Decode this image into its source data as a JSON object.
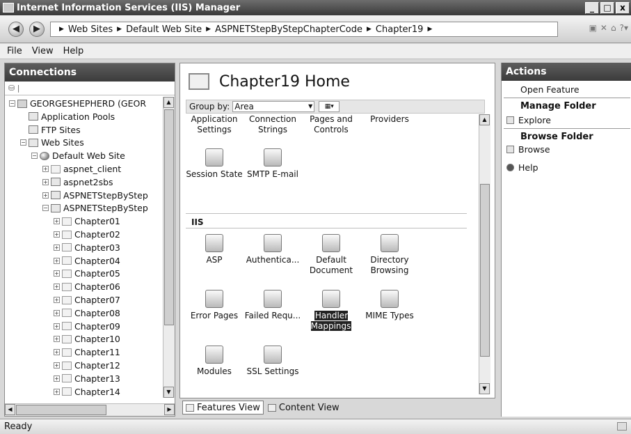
{
  "window": {
    "title": "Internet Information Services (IIS) Manager",
    "controls": [
      "_",
      "□",
      "x"
    ]
  },
  "address": {
    "crumbs": [
      "Web Sites",
      "Default Web Site",
      "ASPNETStepByStepChapterCode",
      "Chapter19"
    ]
  },
  "menu": {
    "items": [
      {
        "label": "File",
        "key": "F"
      },
      {
        "label": "View",
        "key": "V"
      },
      {
        "label": "Help",
        "key": "H"
      }
    ]
  },
  "connections": {
    "title": "Connections",
    "tree": [
      {
        "label": "GEORGESHEPHERD (GEOR",
        "level": 0,
        "exp": "−",
        "icon": "server-icon",
        "cls": "server"
      },
      {
        "label": "Application Pools",
        "level": 1,
        "exp": "",
        "icon": "app-pool-icon",
        "cls": ""
      },
      {
        "label": "FTP Sites",
        "level": 1,
        "exp": "",
        "icon": "ftp-icon",
        "cls": ""
      },
      {
        "label": "Web Sites",
        "level": 1,
        "exp": "−",
        "icon": "web-sites-icon",
        "cls": ""
      },
      {
        "label": "Default Web Site",
        "level": 2,
        "exp": "−",
        "icon": "globe-icon",
        "cls": "globe"
      },
      {
        "label": "aspnet_client",
        "level": 3,
        "exp": "+",
        "icon": "folder-icon",
        "cls": "folder"
      },
      {
        "label": "aspnet2sbs",
        "level": 3,
        "exp": "+",
        "icon": "virtual-dir-icon",
        "cls": ""
      },
      {
        "label": "ASPNETStepByStep",
        "level": 3,
        "exp": "+",
        "icon": "application-icon",
        "cls": ""
      },
      {
        "label": "ASPNETStepByStep",
        "level": 3,
        "exp": "−",
        "icon": "application-icon",
        "cls": ""
      },
      {
        "label": "Chapter01",
        "level": 4,
        "exp": "+",
        "icon": "folder-icon",
        "cls": "folder"
      },
      {
        "label": "Chapter02",
        "level": 4,
        "exp": "+",
        "icon": "folder-icon",
        "cls": "folder"
      },
      {
        "label": "Chapter03",
        "level": 4,
        "exp": "+",
        "icon": "folder-icon",
        "cls": "folder"
      },
      {
        "label": "Chapter04",
        "level": 4,
        "exp": "+",
        "icon": "folder-icon",
        "cls": "folder"
      },
      {
        "label": "Chapter05",
        "level": 4,
        "exp": "+",
        "icon": "folder-icon",
        "cls": "folder"
      },
      {
        "label": "Chapter06",
        "level": 4,
        "exp": "+",
        "icon": "folder-icon",
        "cls": "folder"
      },
      {
        "label": "Chapter07",
        "level": 4,
        "exp": "+",
        "icon": "folder-icon",
        "cls": "folder"
      },
      {
        "label": "Chapter08",
        "level": 4,
        "exp": "+",
        "icon": "folder-icon",
        "cls": "folder"
      },
      {
        "label": "Chapter09",
        "level": 4,
        "exp": "+",
        "icon": "folder-icon",
        "cls": "folder"
      },
      {
        "label": "Chapter10",
        "level": 4,
        "exp": "+",
        "icon": "folder-icon",
        "cls": "folder"
      },
      {
        "label": "Chapter11",
        "level": 4,
        "exp": "+",
        "icon": "folder-icon",
        "cls": "folder"
      },
      {
        "label": "Chapter12",
        "level": 4,
        "exp": "+",
        "icon": "folder-icon",
        "cls": "folder"
      },
      {
        "label": "Chapter13",
        "level": 4,
        "exp": "+",
        "icon": "folder-icon",
        "cls": "folder"
      },
      {
        "label": "Chapter14",
        "level": 4,
        "exp": "+",
        "icon": "folder-icon",
        "cls": "folder"
      }
    ]
  },
  "center": {
    "title": "Chapter19 Home",
    "group_by_label": "Group by:",
    "group_by_value": "Area",
    "aspnet_features": [
      {
        "label": "Application Settings",
        "icon": "application-settings-icon"
      },
      {
        "label": "Connection Strings",
        "icon": "connection-strings-icon"
      },
      {
        "label": "Pages and Controls",
        "icon": "pages-controls-icon"
      },
      {
        "label": "Providers",
        "icon": "providers-icon"
      },
      {
        "label": "Session State",
        "icon": "session-state-icon"
      },
      {
        "label": "SMTP E-mail",
        "icon": "smtp-email-icon"
      }
    ],
    "iis_section": "IIS",
    "iis_features": [
      {
        "label": "ASP",
        "icon": "asp-icon"
      },
      {
        "label": "Authentica...",
        "icon": "authentication-icon"
      },
      {
        "label": "Default Document",
        "icon": "default-document-icon"
      },
      {
        "label": "Directory Browsing",
        "icon": "directory-browsing-icon"
      },
      {
        "label": "Error Pages",
        "icon": "error-pages-icon"
      },
      {
        "label": "Failed Requ...",
        "icon": "failed-requests-icon"
      },
      {
        "label": "Handler Mappings",
        "icon": "handler-mappings-icon",
        "selected": true
      },
      {
        "label": "MIME Types",
        "icon": "mime-types-icon"
      },
      {
        "label": "Modules",
        "icon": "modules-icon"
      },
      {
        "label": "SSL Settings",
        "icon": "ssl-settings-icon"
      }
    ]
  },
  "view_tabs": {
    "features": "Features View",
    "content": "Content View"
  },
  "actions": {
    "title": "Actions",
    "open_feature": "Open Feature",
    "manage_folder": "Manage Folder",
    "explore": "Explore",
    "browse_folder": "Browse Folder",
    "browse": "Browse",
    "help": "Help"
  },
  "status": {
    "text": "Ready"
  }
}
